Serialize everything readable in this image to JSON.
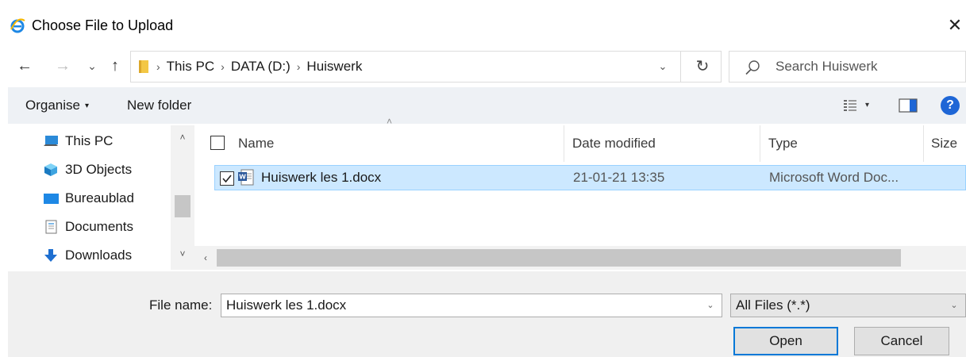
{
  "window": {
    "title": "Choose File to Upload",
    "close_glyph": "✕"
  },
  "nav": {
    "back_glyph": "←",
    "forward_glyph": "→",
    "recent_glyph": "⌄",
    "up_glyph": "↑"
  },
  "address": {
    "crumbs": [
      "This PC",
      "DATA (D:)",
      "Huiswerk"
    ],
    "separator": "›",
    "dropdown_glyph": "⌄",
    "refresh_glyph": "↻"
  },
  "search": {
    "placeholder": "Search Huiswerk"
  },
  "toolbar": {
    "organise_label": "Organise",
    "organise_caret": "▾",
    "new_folder_label": "New folder",
    "views_caret": "▾",
    "help_label": "?"
  },
  "nav_pane": {
    "items": [
      {
        "label": "This PC",
        "icon": "this-pc-icon"
      },
      {
        "label": "3D Objects",
        "icon": "3d-objects-icon"
      },
      {
        "label": "Bureaublad",
        "icon": "desktop-icon"
      },
      {
        "label": "Documents",
        "icon": "documents-icon"
      },
      {
        "label": "Downloads",
        "icon": "downloads-icon"
      }
    ],
    "scroll_up_glyph": "˄",
    "scroll_down_glyph": "˅"
  },
  "file_list": {
    "columns": {
      "name": "Name",
      "date": "Date modified",
      "type": "Type",
      "size": "Size"
    },
    "sort_glyph": "˄",
    "rows": [
      {
        "name": "Huiswerk les 1.docx",
        "date": "21-01-21 13:35",
        "type": "Microsoft Word Doc...",
        "selected": true
      }
    ],
    "hscroll_left_glyph": "‹"
  },
  "footer": {
    "file_name_label": "File name:",
    "file_name_value": "Huiswerk les 1.docx",
    "file_name_drop_glyph": "⌄",
    "filter_value": "All Files (*.*)",
    "filter_drop_glyph": "⌄",
    "open_label": "Open",
    "cancel_label": "Cancel"
  },
  "colors": {
    "selection": "#cce8ff",
    "selection_border": "#99d1ff",
    "toolbar_bg": "#eef1f5",
    "primary_button_border": "#0078d7",
    "help_blue": "#1e66d6"
  }
}
